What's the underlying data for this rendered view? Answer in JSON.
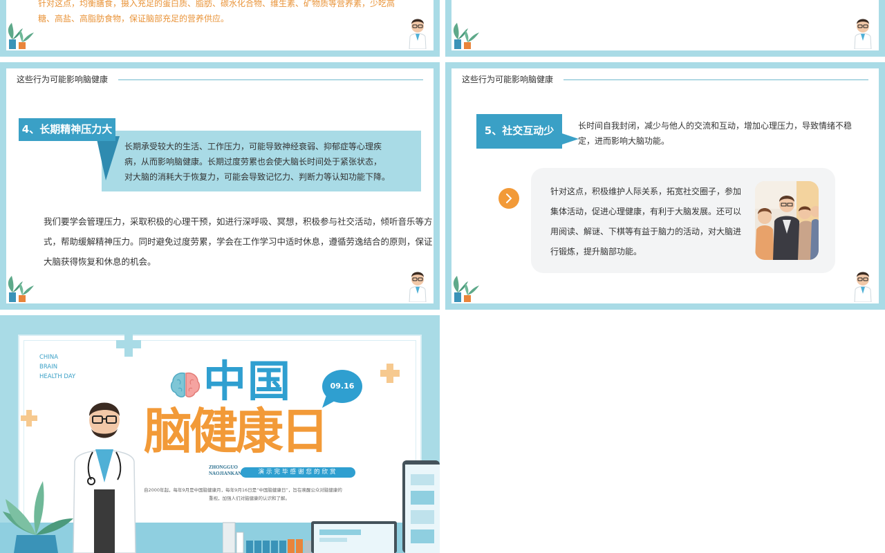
{
  "slide1": {
    "text_line1": "针对这点，均衡膳食，摄入充足的蛋白质、脂肪、碳水化合物、维生素、矿物质等营养素，少吃高",
    "text_line2": "糖、高盐、高脂肪食物，保证脑部充足的营养供应。"
  },
  "slide3": {
    "header": "这些行为可能影响脑健康",
    "label": "4、长期精神压力大",
    "desc_line1": "长期承受较大的生活、工作压力，可能导致神经衰弱、抑郁症等心理疾",
    "desc_line2": "病，从而影响脑健康。长期过度劳累也会使大脑长时间处于紧张状态，",
    "desc_line3": "对大脑的消耗大于恢复力，可能会导致记忆力、判断力等认知功能下降。",
    "body_line1": "我们要学会管理压力，采取积极的心理干预，如进行深呼吸、冥想，积极参与社交活动，倾听音乐等方",
    "body_line2": "式，帮助缓解精神压力。同时避免过度劳累，学会在工作学习中适时休息，遵循劳逸结合的原则，保证",
    "body_line3": "大脑获得恢复和休息的机会。"
  },
  "slide4": {
    "header": "这些行为可能影响脑健康",
    "label": "5、社交互动少",
    "desc_line1": "长时间自我封闭，减少与他人的交流和互动，增加心理压力，导致情绪不稳",
    "desc_line2": "定，进而影响大脑功能。",
    "card_line1": "针对这点，积极维护人际关系，拓宽社交圈子，参加",
    "card_line2": "集体活动，促进心理健康，有利于大脑发展。还可以",
    "card_line3": "用阅读、解谜、下棋等有益于脑力的活动，对大脑进",
    "card_line4": "行锻炼，提升脑部功能。"
  },
  "slide5": {
    "english_line1": "CHINA",
    "english_line2": "BRAIN",
    "english_line3": "HEALTH DAY",
    "title_line1": "中国",
    "title_line2": "脑健康日",
    "date": "09.16",
    "pinyin_line1": "ZHONGGUO",
    "pinyin_line2": "NAOJIANKANGRI",
    "banner": "演示完毕感谢您的欣赏",
    "intro_line1": "自2000年起，每年9月是中国脑健康月，每年9月16日是“中国脑健康日”，旨在唤醒公众对脑健康的",
    "intro_line2": "重视，加强人们对脑健康的认识和了解。"
  },
  "colors": {
    "frame": "#a9dbe6",
    "label_blue": "#3aa0c6",
    "orange": "#f29a38",
    "title_blue": "#2f9fd0",
    "title_orange": "#f29a38"
  }
}
